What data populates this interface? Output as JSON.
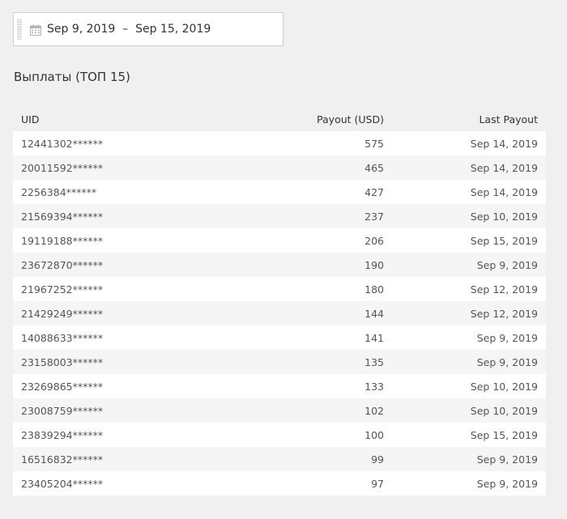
{
  "date_range": {
    "text": "Sep 9, 2019  –  Sep 15, 2019"
  },
  "section": {
    "title": "Выплаты (ТОП 15)"
  },
  "table": {
    "headers": {
      "uid": "UID",
      "payout": "Payout (USD)",
      "last_payout": "Last Payout"
    },
    "rows": [
      {
        "uid": "12441302******",
        "payout": "575",
        "last": "Sep 14, 2019"
      },
      {
        "uid": "20011592******",
        "payout": "465",
        "last": "Sep 14, 2019"
      },
      {
        "uid": "2256384******",
        "payout": "427",
        "last": "Sep 14, 2019"
      },
      {
        "uid": "21569394******",
        "payout": "237",
        "last": "Sep 10, 2019"
      },
      {
        "uid": "19119188******",
        "payout": "206",
        "last": "Sep 15, 2019"
      },
      {
        "uid": "23672870******",
        "payout": "190",
        "last": "Sep 9, 2019"
      },
      {
        "uid": "21967252******",
        "payout": "180",
        "last": "Sep 12, 2019"
      },
      {
        "uid": "21429249******",
        "payout": "144",
        "last": "Sep 12, 2019"
      },
      {
        "uid": "14088633******",
        "payout": "141",
        "last": "Sep 9, 2019"
      },
      {
        "uid": "23158003******",
        "payout": "135",
        "last": "Sep 9, 2019"
      },
      {
        "uid": "23269865******",
        "payout": "133",
        "last": "Sep 10, 2019"
      },
      {
        "uid": "23008759******",
        "payout": "102",
        "last": "Sep 10, 2019"
      },
      {
        "uid": "23839294******",
        "payout": "100",
        "last": "Sep 15, 2019"
      },
      {
        "uid": "16516832******",
        "payout": "99",
        "last": "Sep 9, 2019"
      },
      {
        "uid": "23405204******",
        "payout": "97",
        "last": "Sep 9, 2019"
      }
    ]
  }
}
